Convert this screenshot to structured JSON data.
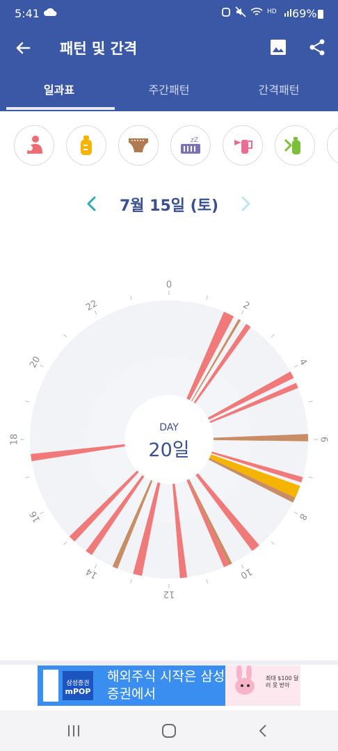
{
  "status": {
    "time": "5:41",
    "battery": "69%"
  },
  "appbar": {
    "title": "패턴 및 간격"
  },
  "tabs": [
    {
      "label": "일과표"
    },
    {
      "label": "주간패턴"
    },
    {
      "label": "간격패턴"
    }
  ],
  "categories": [
    "breastfeed-icon",
    "bottle-icon",
    "diaper-icon",
    "sleep-crib-icon",
    "pump-icon",
    "formula-bottle-icon",
    "more-category-icon"
  ],
  "date": {
    "label": "7월 15일 (토)"
  },
  "clock": {
    "center_label": "DAY",
    "center_value": "20일",
    "hour_labels": [
      "0",
      "2",
      "4",
      "6",
      "8",
      "10",
      "12",
      "14",
      "16",
      "18",
      "20",
      "22"
    ],
    "colors": {
      "feed": "#f07a7a",
      "diaper": "#c98d66",
      "bottle": "#f5b400",
      "face": "#f1f3f7"
    },
    "events": [
      {
        "type": "feed",
        "start": 1.55,
        "end": 1.85
      },
      {
        "type": "diaper",
        "start": 2.0,
        "end": 2.07
      },
      {
        "type": "feed",
        "start": 2.25,
        "end": 2.4
      },
      {
        "type": "feed",
        "start": 4.05,
        "end": 4.25
      },
      {
        "type": "feed",
        "start": 4.4,
        "end": 4.55
      },
      {
        "type": "diaper",
        "start": 5.85,
        "end": 6.05
      },
      {
        "type": "feed",
        "start": 7.05,
        "end": 7.2
      },
      {
        "type": "bottle",
        "start": 7.3,
        "end": 7.65
      },
      {
        "type": "diaper",
        "start": 7.65,
        "end": 7.8
      },
      {
        "type": "feed",
        "start": 9.3,
        "end": 9.55
      },
      {
        "type": "diaper",
        "start": 10.2,
        "end": 10.3
      },
      {
        "type": "feed",
        "start": 10.3,
        "end": 10.45
      },
      {
        "type": "feed",
        "start": 11.5,
        "end": 11.7
      },
      {
        "type": "feed",
        "start": 12.75,
        "end": 13.0
      },
      {
        "type": "diaper",
        "start": 13.45,
        "end": 13.6
      },
      {
        "type": "feed",
        "start": 14.25,
        "end": 14.45
      },
      {
        "type": "feed",
        "start": 14.85,
        "end": 15.05
      },
      {
        "type": "feed",
        "start": 17.4,
        "end": 17.6
      }
    ]
  },
  "ad": {
    "brand_small": "삼성증권",
    "brand": "mPOP",
    "text": "해외주식 시작은 삼성증권에서",
    "img_text": "최대 $100 달러 못 받아"
  }
}
